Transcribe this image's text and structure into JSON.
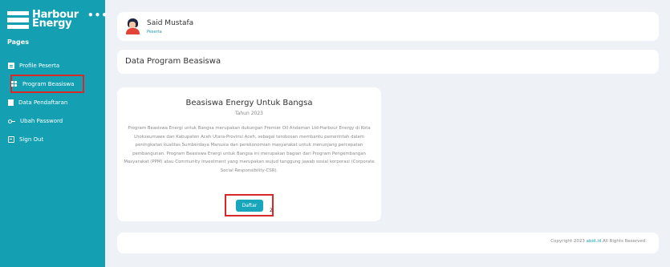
{
  "brand": {
    "name_line1": "Harbour",
    "name_line2": "Energy",
    "menu_dots": "•••"
  },
  "sidebar": {
    "section_label": "Pages",
    "items": [
      {
        "label": "Profile Peserta",
        "icon": "id-card-icon"
      },
      {
        "label": "Program Beasiswa",
        "icon": "grid-icon"
      },
      {
        "label": "Data Pendaftaran",
        "icon": "file-icon"
      },
      {
        "label": "Ubah Password",
        "icon": "key-icon"
      },
      {
        "label": "Sign Out",
        "icon": "sign-out-icon"
      }
    ]
  },
  "profile": {
    "name": "Said Mustafa",
    "role": "Peserta"
  },
  "page_title": "Data Program Beasiswa",
  "program": {
    "title": "Beasiswa Energy Untuk Bangsa",
    "year": "Tahun 2023",
    "description": "Program Beasiswa Energi untuk Bangsa merupakan dukungan Premier Oil Andaman Ltd-Harbour Energy di Kota Lhokseumawe dan Kabupaten Aceh Utara-Provinsi Aceh, sebagai terobosan membantu pemerintah dalam peningkatan kualitas Sumberdaya Manusia dan perekonomian masyarakat untuk menunjang percepatan pembangunan. Program Beasiswa Energi untuk Bangsa ini merupakan bagian dari Program Pengembangan Masyarakat (PPM) atau Community Investment yang merupakan wujud tanggung jawab sosial korporasi (Corporate Social Responsibility-CSR).",
    "button_label": "Daftar",
    "annotation": "2"
  },
  "footer": {
    "prefix": "Copyright 2023 ",
    "link": "abid.id",
    "suffix": " All Rights Reserved."
  },
  "colors": {
    "sidebar": "#14a0b2",
    "accent": "#17a6bb",
    "highlight": "#d82828",
    "background": "#eef1f6"
  }
}
